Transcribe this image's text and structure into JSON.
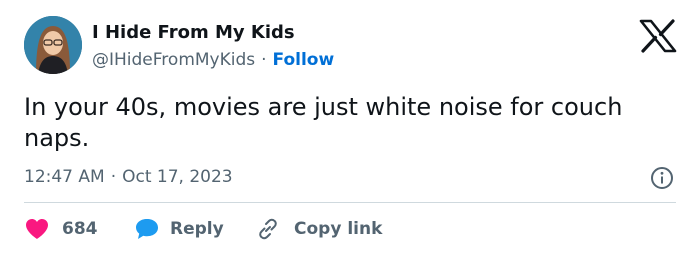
{
  "author": {
    "display_name": "I Hide From My Kids",
    "handle": "@IHideFromMyKids",
    "separator": "·",
    "follow_label": "Follow"
  },
  "tweet": {
    "text": "In your 40s, movies are just white noise for couch naps.",
    "time": "12:47 AM",
    "date": "Oct 17, 2023",
    "separator": "·"
  },
  "actions": {
    "likes_count": "684",
    "reply_label": "Reply",
    "copy_link_label": "Copy link"
  },
  "icons": {
    "platform_logo": "x-logo-icon",
    "info": "info-icon",
    "like": "heart-icon",
    "reply": "reply-bubble-icon",
    "copy": "link-icon"
  },
  "colors": {
    "text_primary": "#0f1419",
    "text_secondary": "#536471",
    "link_blue": "#006fd6",
    "heart_pink": "#f91880",
    "reply_blue": "#1d9bf0",
    "divider": "#cfd9de"
  }
}
